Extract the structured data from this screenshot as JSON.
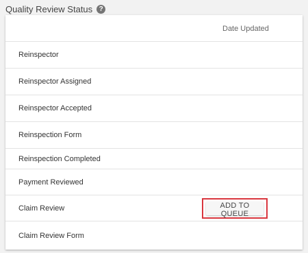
{
  "section": {
    "title": "Quality Review Status",
    "help_icon": "?"
  },
  "table": {
    "column_date": "Date Updated",
    "rows": [
      {
        "label": "Reinspector"
      },
      {
        "label": "Reinspector Assigned"
      },
      {
        "label": "Reinspector Accepted"
      },
      {
        "label": "Reinspection Form"
      },
      {
        "label": "Reinspection Completed"
      },
      {
        "label": "Payment Reviewed"
      },
      {
        "label": "Claim Review",
        "action": "ADD TO QUEUE"
      },
      {
        "label": "Claim Review Form"
      }
    ]
  },
  "colors": {
    "highlight_border": "#d9363e",
    "background": "#f2f2f2"
  }
}
